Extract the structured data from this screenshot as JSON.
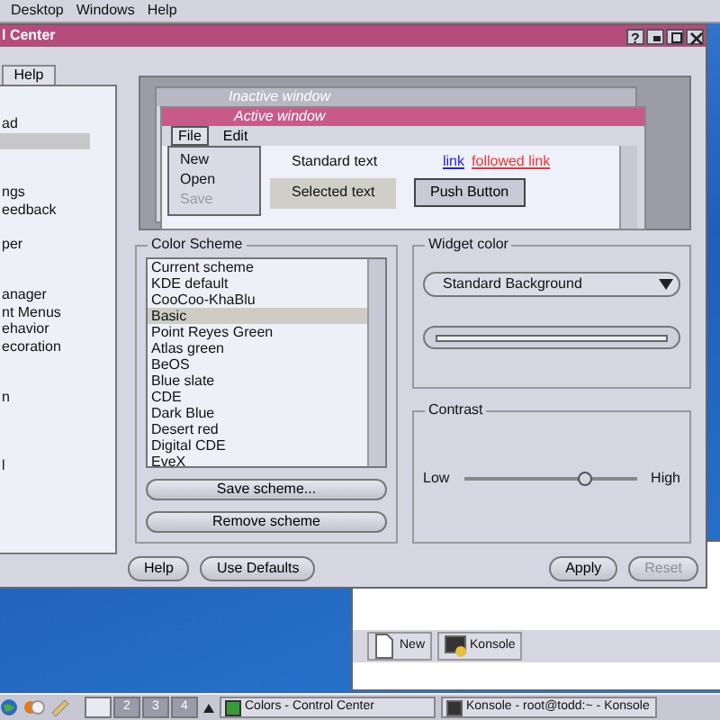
{
  "top_menu": [
    "Desktop",
    "Windows",
    "Help"
  ],
  "window": {
    "title": "l Center",
    "help_button": "?"
  },
  "side_tab": {
    "label": "Help",
    "selected": true
  },
  "sidebar": {
    "items": [
      {
        "label": "ad",
        "selected": false
      },
      {
        "selected": true
      },
      {
        "label": "ngs",
        "selected": false
      },
      {
        "label": "eedback",
        "selected": false
      },
      {
        "label": "per",
        "selected": false
      },
      {
        "label": "anager",
        "selected": false
      },
      {
        "label": "nt Menus",
        "selected": false
      },
      {
        "label": "ehavior",
        "selected": false
      },
      {
        "label": "ecoration",
        "selected": false
      },
      {
        "label": "n",
        "selected": false
      },
      {
        "label": "l",
        "selected": false
      }
    ]
  },
  "preview": {
    "inactive_title": "Inactive window",
    "active_title": "Active window",
    "menu": [
      {
        "label": "File",
        "selected": true
      },
      {
        "label": "Edit",
        "selected": false
      }
    ],
    "popup": [
      {
        "label": "New",
        "disabled": false
      },
      {
        "label": "Open",
        "disabled": false
      },
      {
        "label": "Save",
        "disabled": true
      }
    ],
    "standard_text": "Standard text",
    "link": "link",
    "followed_link": "followed link",
    "selected_text": "Selected text",
    "push_button": "Push Button"
  },
  "color_scheme": {
    "title": "Color Scheme",
    "items": [
      {
        "label": "Current scheme",
        "selected": false
      },
      {
        "label": "KDE default",
        "selected": false
      },
      {
        "label": "CooCoo-KhaBlu",
        "selected": false
      },
      {
        "label": "Basic",
        "selected": true
      },
      {
        "label": "Point Reyes Green",
        "selected": false
      },
      {
        "label": "Atlas green",
        "selected": false
      },
      {
        "label": "BeOS",
        "selected": false
      },
      {
        "label": "Blue slate",
        "selected": false
      },
      {
        "label": "CDE",
        "selected": false
      },
      {
        "label": "Dark Blue",
        "selected": false
      },
      {
        "label": "Desert red",
        "selected": false
      },
      {
        "label": "Digital CDE",
        "selected": false
      },
      {
        "label": "EveX",
        "selected": false
      }
    ],
    "buttons": [
      "Save scheme...",
      "Remove scheme"
    ]
  },
  "widget_color": {
    "title": "Widget color",
    "value": "Standard Background"
  },
  "contrast": {
    "title": "Contrast",
    "low": "Low",
    "high": "High",
    "level": 0.7
  },
  "footer_buttons": [
    {
      "label": "Help",
      "disabled": false
    },
    {
      "label": "Use Defaults",
      "disabled": false
    },
    {
      "label": "Apply",
      "disabled": false
    },
    {
      "label": "Reset",
      "disabled": true
    }
  ],
  "konsole_toolbar": [
    "New",
    "Konsole"
  ],
  "taskbar": {
    "pager": [
      {
        "selected": true
      },
      {
        "label": "2",
        "selected": false
      },
      {
        "label": "3",
        "selected": false
      },
      {
        "label": "4",
        "selected": false
      }
    ],
    "tasks": [
      "Colors - Control Center",
      "Konsole - root@todd:~ - Konsole"
    ]
  }
}
